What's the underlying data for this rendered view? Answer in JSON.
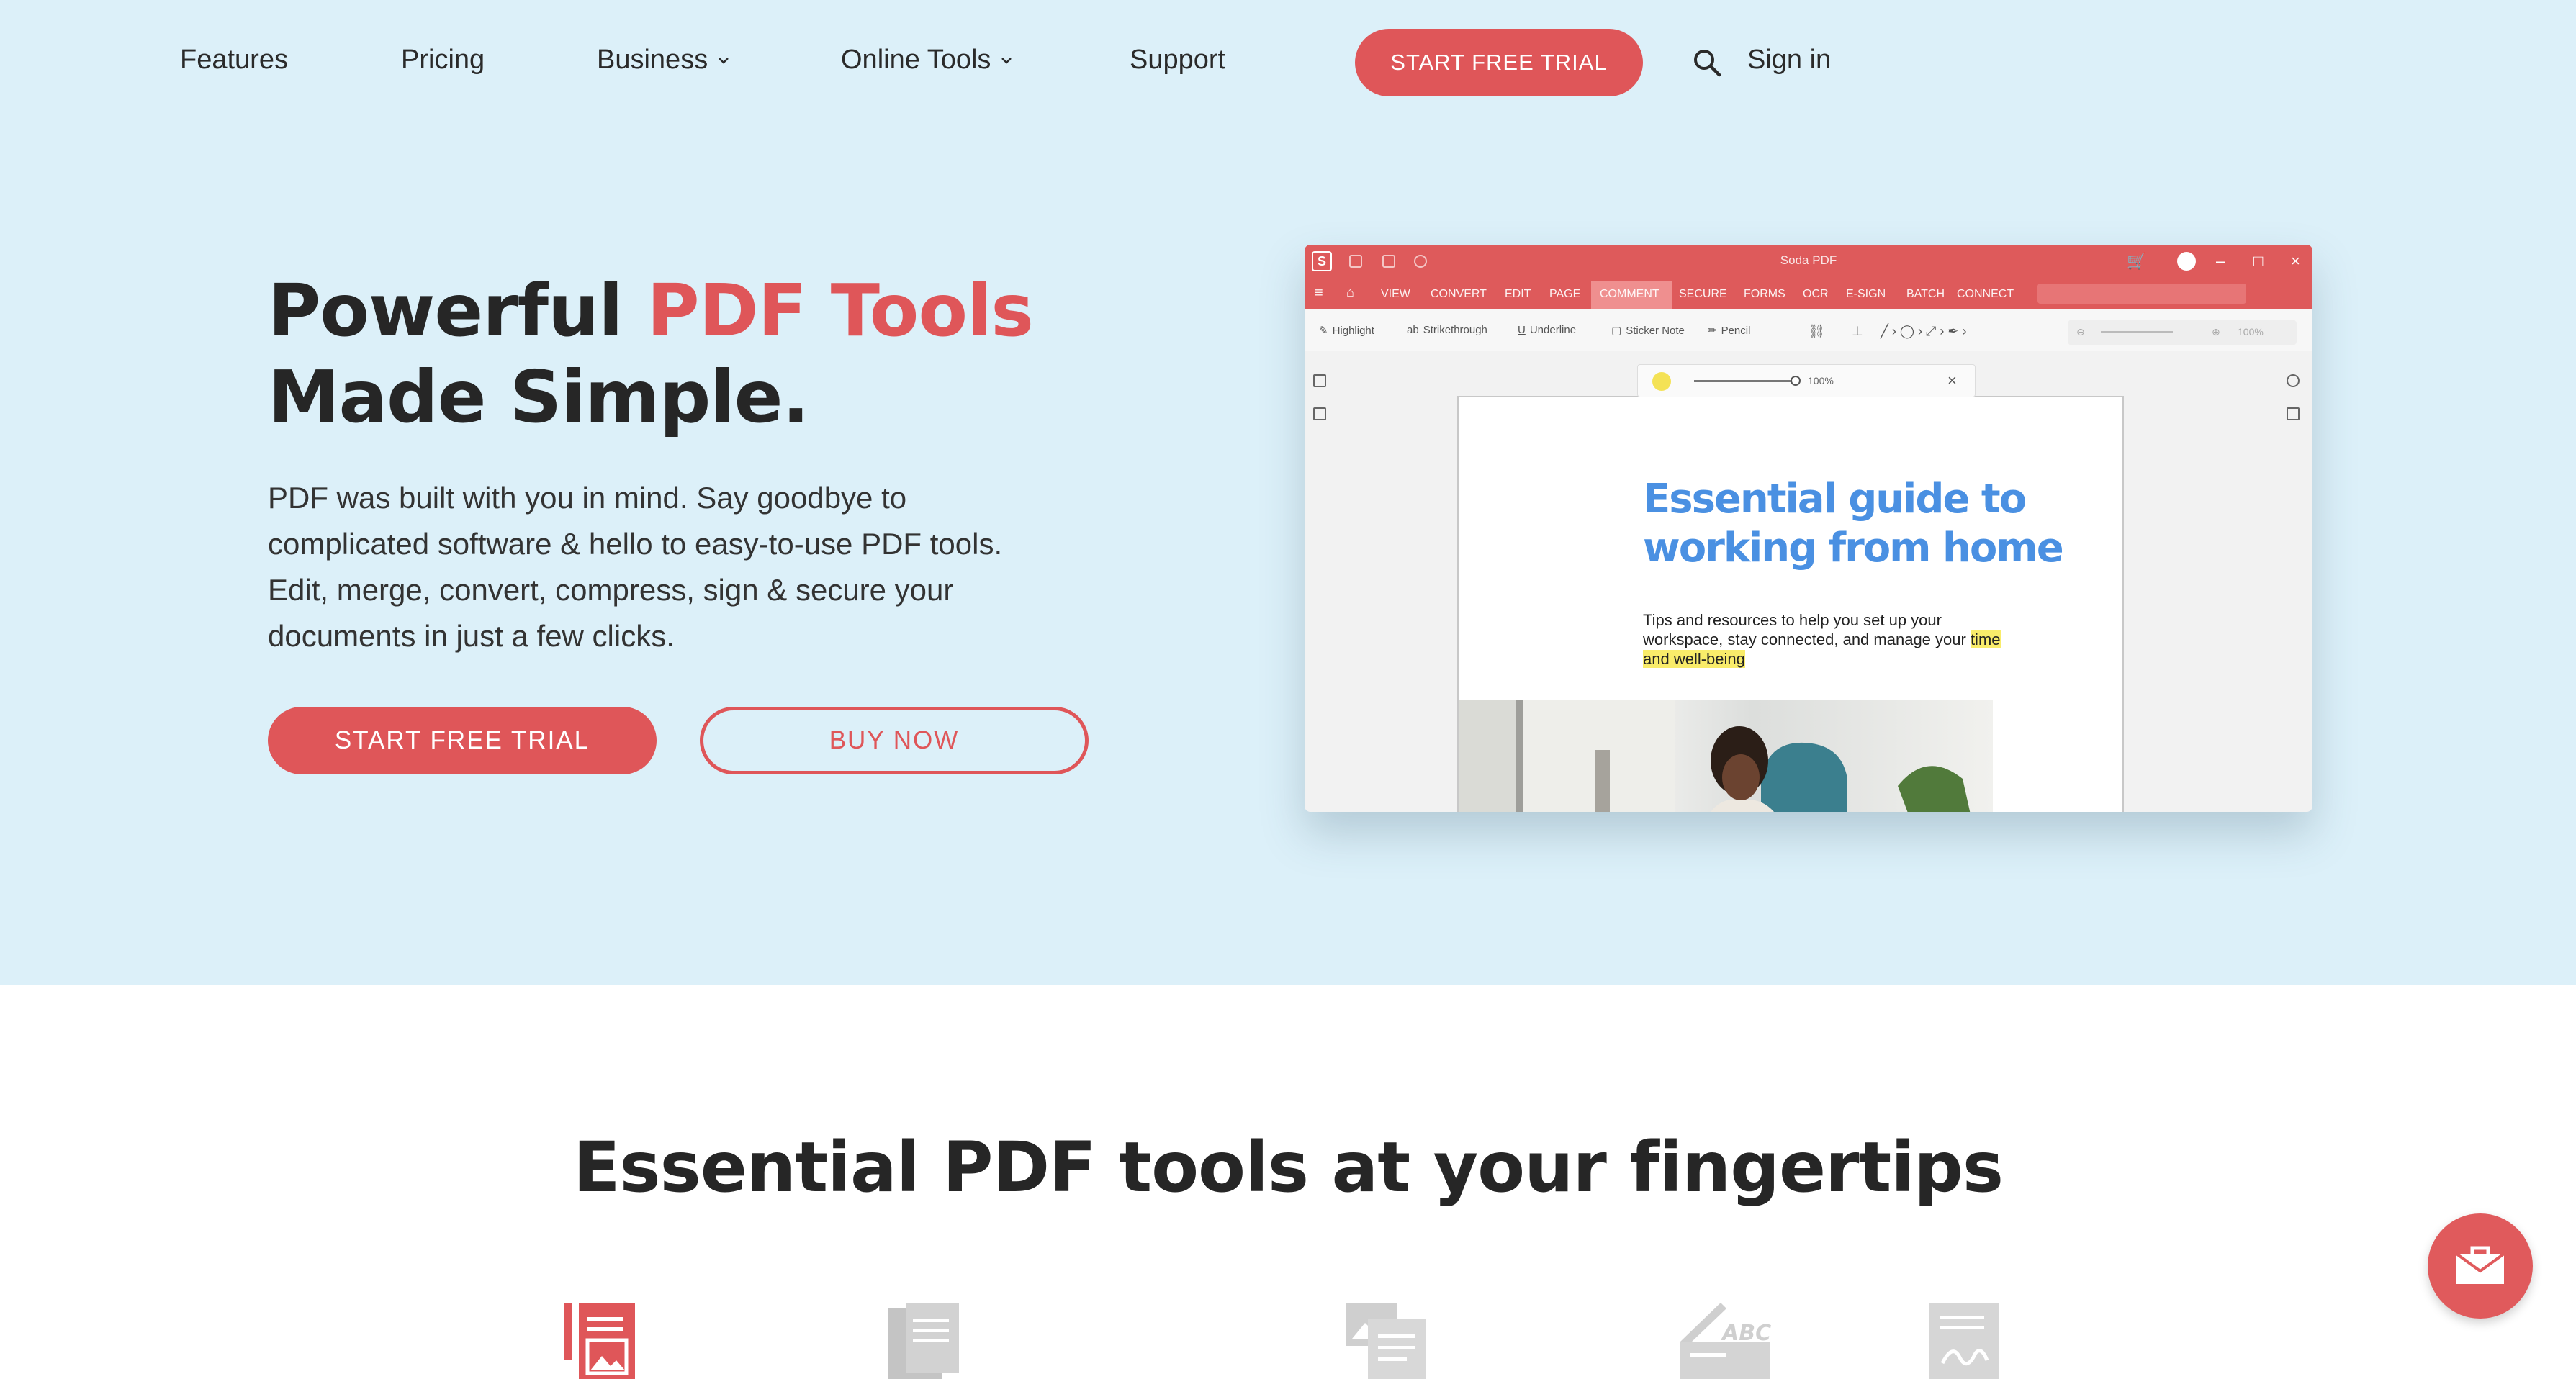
{
  "nav": {
    "items": [
      {
        "label": "Features"
      },
      {
        "label": "Pricing"
      },
      {
        "label": "Business",
        "has_dropdown": true
      },
      {
        "label": "Online Tools",
        "has_dropdown": true
      },
      {
        "label": "Support"
      }
    ],
    "cta_label": "START FREE TRIAL",
    "search_icon": "search-icon",
    "signin_label": "Sign in"
  },
  "hero": {
    "headline_part1": "Powerful ",
    "headline_accent": "PDF Tools",
    "headline_part2": "Made Simple.",
    "lead": "PDF was built with you in mind. Say goodbye to complicated software & hello to easy-to-use PDF tools. Edit, merge, convert, compress, sign & secure your documents in just a few clicks.",
    "primary_button": "START FREE TRIAL",
    "secondary_button": "BUY NOW"
  },
  "app_preview": {
    "window_title": "Soda PDF",
    "logo_letter": "S",
    "menu": [
      "VIEW",
      "CONVERT",
      "EDIT",
      "PAGE",
      "COMMENT",
      "SECURE",
      "FORMS",
      "OCR",
      "E-SIGN",
      "BATCH",
      "CONNECT"
    ],
    "active_menu": "COMMENT",
    "tools": [
      "Highlight",
      "Strikethrough",
      "Underline",
      "Sticker Note",
      "Pencil"
    ],
    "zoom": "100%",
    "popover_opacity": "100%",
    "document": {
      "title": "Essential guide to working from home",
      "subtitle_plain": "Tips and resources to help you set up your workspace, stay connected, and manage your ",
      "subtitle_highlight": "time and well-being"
    }
  },
  "section": {
    "title": "Essential PDF tools at your fingertips"
  },
  "colors": {
    "accent": "#df5659",
    "hero_bg": "#dcf0f9",
    "doc_title": "#4a90e2",
    "highlight": "#f9ec6a"
  },
  "chat": {
    "icon": "mail-icon"
  }
}
